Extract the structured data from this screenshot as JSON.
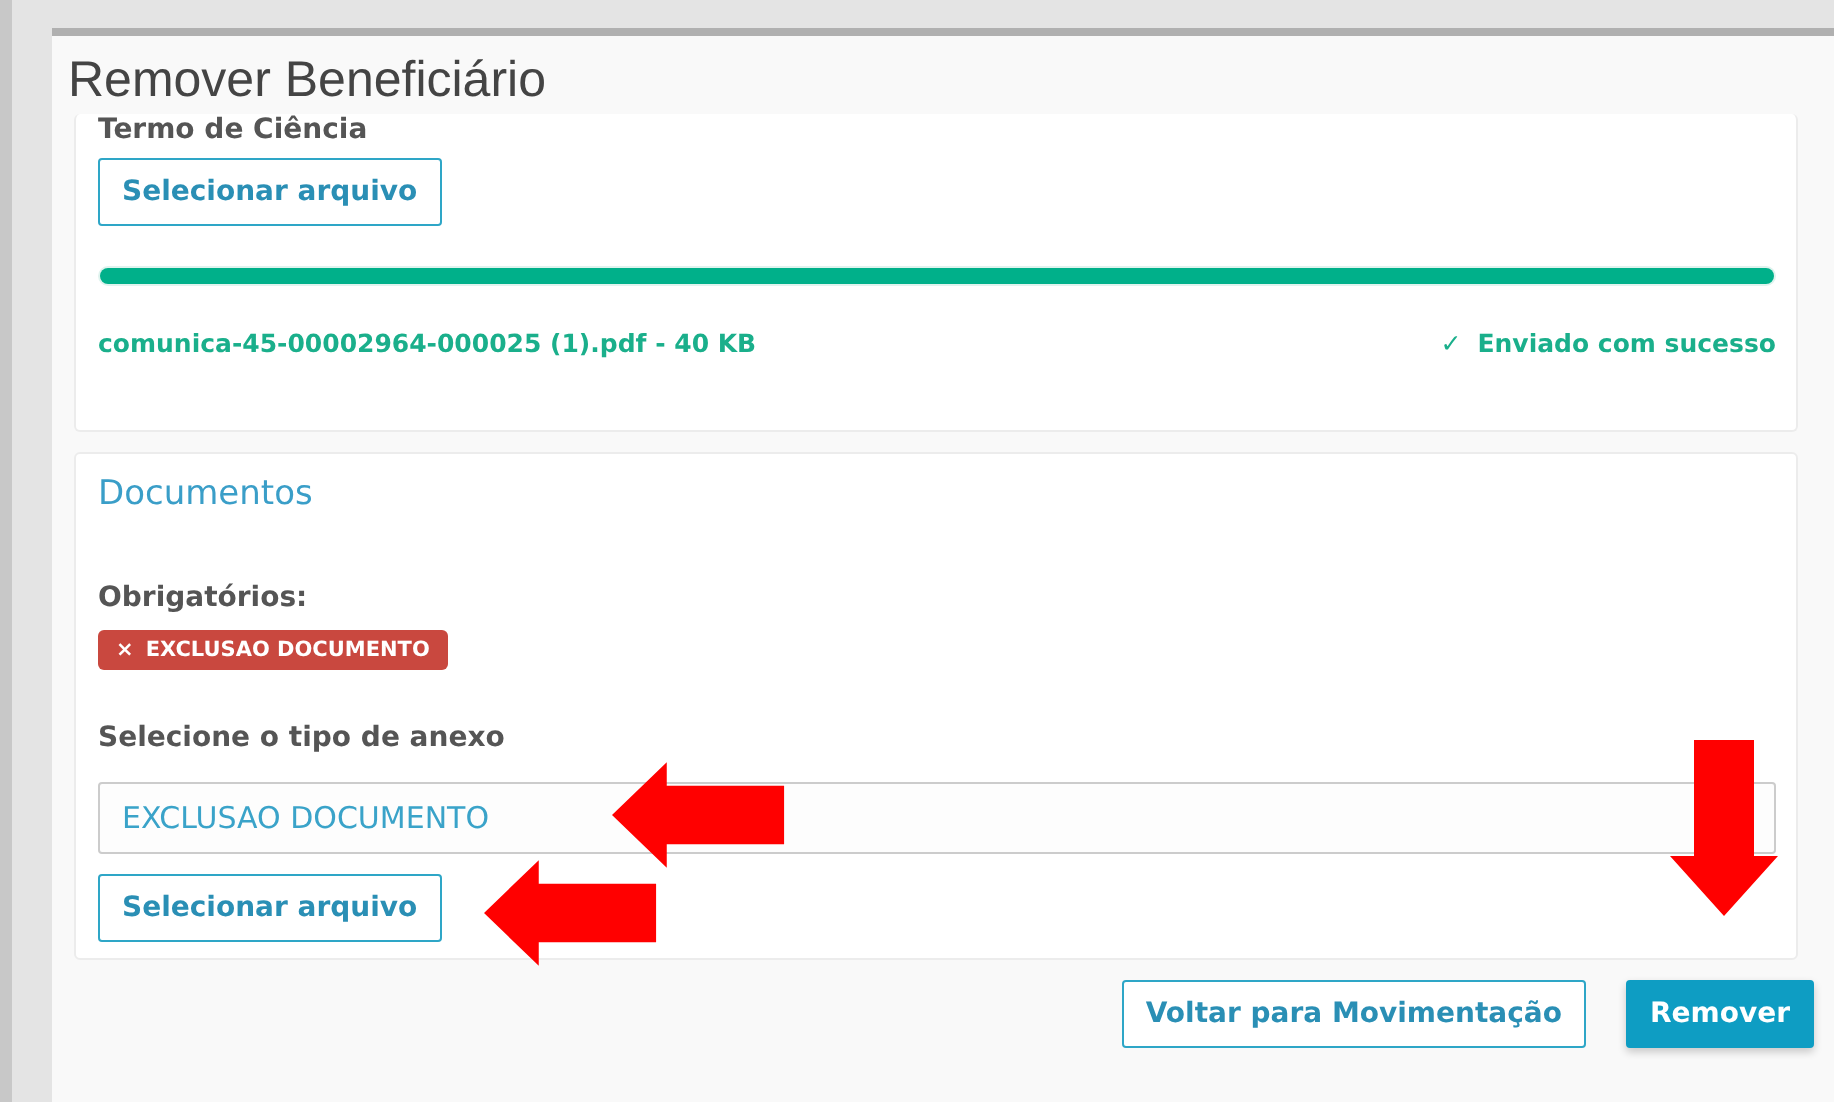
{
  "window": {
    "title": "Remover Beneficiário"
  },
  "upload_card": {
    "label": "Termo de Ciência",
    "select_button": "Selecionar arquivo",
    "progress": {
      "level": 1
    },
    "file_name": "comunica-45-00002964-000025 (1).pdf - 40 KB",
    "status": "Enviado com sucesso",
    "status_icon": "✓"
  },
  "documents_card": {
    "title": "Documentos",
    "required_label": "Obrigatórios:",
    "required_tags": [
      {
        "icon": "×",
        "label": "EXCLUSAO DOCUMENTO"
      }
    ],
    "type_label": "Selecione o tipo de anexo",
    "type_value": "EXCLUSAO DOCUMENTO",
    "select_button": "Selecionar arquivo"
  },
  "buttons": [
    {
      "label": "Voltar para Movimentação",
      "kind": "secondary"
    },
    {
      "label": "Remover",
      "kind": "primary"
    }
  ]
}
